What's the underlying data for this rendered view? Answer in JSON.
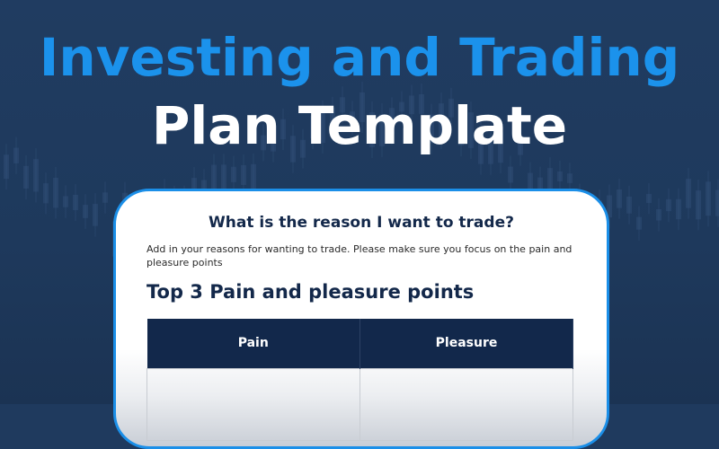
{
  "title": {
    "line1": "Investing and Trading",
    "line2": "Plan Template"
  },
  "colors": {
    "background": "#1f3a5e",
    "accent": "#1b92ec",
    "table_header": "#12284b"
  },
  "document": {
    "question": "What is the reason I want to trade?",
    "description": "Add in your reasons for wanting to trade. Please make sure you focus on the pain and pleasure points",
    "section_heading": "Top 3 Pain and pleasure points",
    "table": {
      "headers": [
        "Pain",
        "Pleasure"
      ]
    }
  }
}
